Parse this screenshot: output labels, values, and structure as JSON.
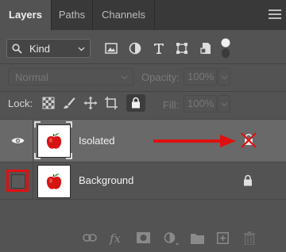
{
  "tabs": [
    {
      "label": "Layers",
      "active": true
    },
    {
      "label": "Paths",
      "active": false
    },
    {
      "label": "Channels",
      "active": false
    }
  ],
  "filter": {
    "kind_label": "Kind",
    "icons": [
      "pixel-filter-icon",
      "adjustment-filter-icon",
      "type-filter-icon",
      "shape-filter-icon",
      "smart-object-filter-icon",
      "filter-toggle-icon"
    ]
  },
  "blend": {
    "mode": "Normal",
    "opacity_label": "Opacity:",
    "opacity_value": "100%"
  },
  "lock": {
    "label": "Lock:",
    "fill_label": "Fill:",
    "fill_value": "100%"
  },
  "layers": [
    {
      "name": "Isolated",
      "visible": true,
      "selected": true,
      "locked": false
    },
    {
      "name": "Background",
      "visible": false,
      "selected": false,
      "locked": true
    }
  ],
  "bottom_toolbar": {
    "fx_label": "fx",
    "icons": [
      "link-layers-icon",
      "fx-icon",
      "add-mask-icon",
      "new-adjustment-icon",
      "new-group-icon",
      "new-layer-icon",
      "delete-layer-icon"
    ]
  },
  "colors": {
    "panel_bg": "#535353",
    "tab_bar_bg": "#393939",
    "selected_row_bg": "#696969",
    "annotation_red": "#e01010"
  }
}
